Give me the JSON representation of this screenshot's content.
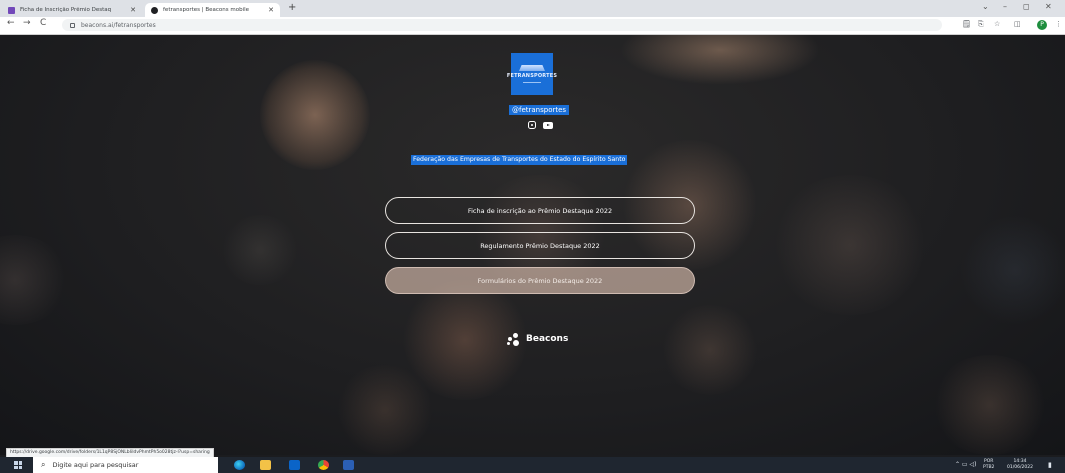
{
  "browser": {
    "tabs": [
      {
        "title": "Ficha de Inscrição Prêmio Destaq",
        "active": false,
        "favicon_color": "#7248b9"
      },
      {
        "title": "fetransportes | Beacons mobile",
        "active": true,
        "favicon_color": "#202124"
      }
    ],
    "new_tab_label": "+",
    "tab_close_label": "✕",
    "url": "beacons.ai/fetransportes",
    "nav": {
      "back": "←",
      "forward": "→",
      "reload": "C"
    },
    "window_controls": {
      "list": "⌄",
      "minimize": "–",
      "maximize": "◻",
      "close": "✕"
    },
    "toolbar_icons": [
      "🗒",
      "⎘",
      "☆",
      "◫",
      "⋮"
    ],
    "profile_initial": "P"
  },
  "profile": {
    "logo_text": "FETRANSPORTES",
    "handle": "@fetransportes",
    "bio": "Federação das Empresas de Transportes do Estado do Espírito Santo",
    "social_icons": [
      "instagram-icon",
      "youtube-icon"
    ]
  },
  "links": [
    {
      "label": "Ficha de inscrição ao Prêmio Destaque 2022",
      "highlighted": false
    },
    {
      "label": "Regulamento Prêmio Destaque 2022",
      "highlighted": false
    },
    {
      "label": "Formulários do Prêmio Destaque 2022",
      "highlighted": true
    }
  ],
  "footer": {
    "brand": "Beacons"
  },
  "status_url": "https://drive.google.com/drive/folders/1L1qP8SjONLbIiIdvPhmtPh5o028tjz-l?usp=sharing",
  "taskbar": {
    "search_placeholder": "Digite aqui para pesquisar",
    "search_icon": "⌕",
    "language": "POR",
    "layout": "PTB2",
    "time": "14:34",
    "date": "01/06/2022",
    "tray_icons": "⌃  ▭  ◁)",
    "notification_icon": "▮"
  },
  "colors": {
    "accent_blue": "#1a6fd8",
    "button_border": "#e8e4e0",
    "highlighted_button": "#cdb4a5"
  }
}
